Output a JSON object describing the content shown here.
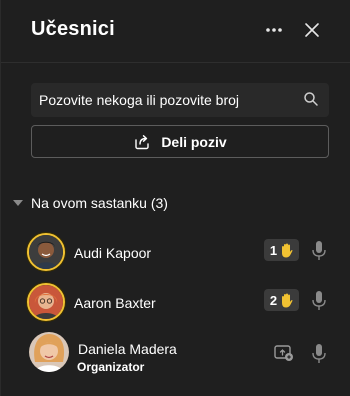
{
  "header": {
    "title": "Učesnici"
  },
  "search": {
    "placeholder": "Pozovite nekoga ili pozovite broj"
  },
  "share": {
    "label": "Deli poziv"
  },
  "section": {
    "label": "Na ovom sastanku (3)"
  },
  "participants": [
    {
      "name": "Audi Kapoor",
      "hand_order": "1",
      "role": ""
    },
    {
      "name": "Aaron Baxter",
      "hand_order": "2",
      "role": ""
    },
    {
      "name": "Daniela Madera",
      "role": "Organizator"
    }
  ],
  "colors": {
    "background": "#1f1f1f",
    "accent_hand": "#f1c232",
    "badge_bg": "#3b3b3b"
  },
  "icons": [
    "more-icon",
    "close-icon",
    "search-icon",
    "share-icon",
    "chevron-down-icon",
    "raised-hand-icon",
    "microphone-icon",
    "present-icon"
  ]
}
